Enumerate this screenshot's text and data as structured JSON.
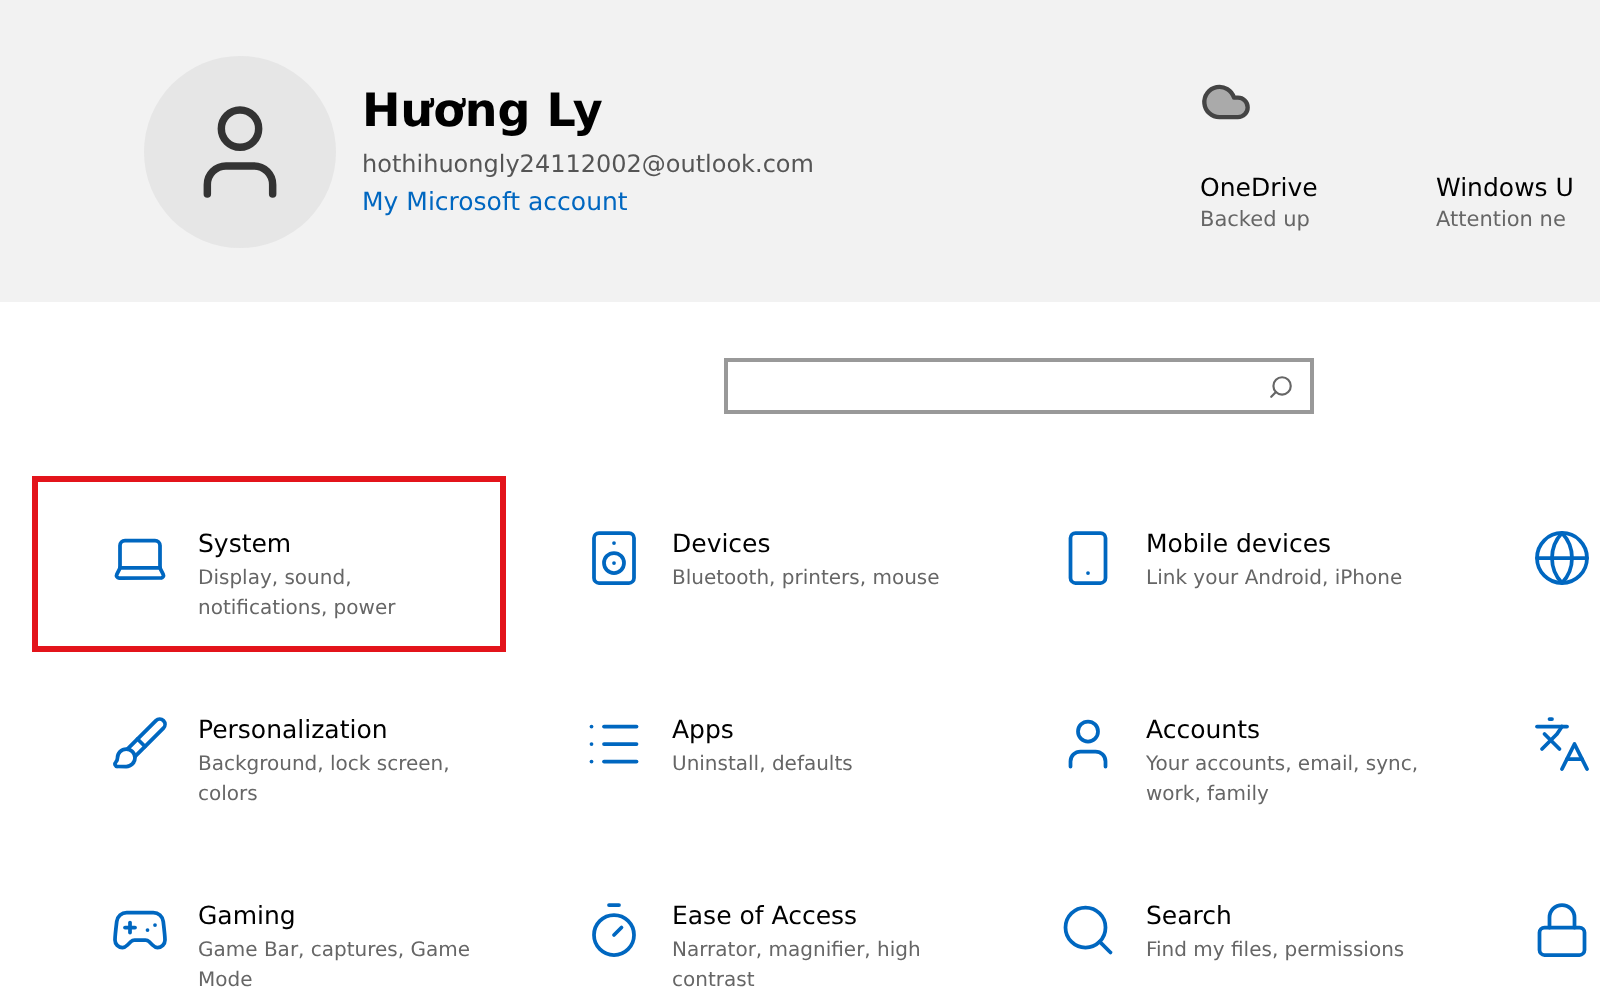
{
  "profile": {
    "name": "Hương Ly",
    "email": "hothihuongly24112002@outlook.com",
    "account_link": "My Microsoft account"
  },
  "status": [
    {
      "title": "OneDrive",
      "subtitle": "Backed up",
      "kind": "onedrive"
    },
    {
      "title": "Windows U",
      "subtitle": "Attention ne",
      "kind": "update"
    }
  ],
  "tiles": [
    {
      "kind": "full",
      "title": "System",
      "subtitle": "Display, sound, notifications, power",
      "highlighted": true
    },
    {
      "kind": "full",
      "title": "Devices",
      "subtitle": "Bluetooth, printers, mouse",
      "highlighted": false
    },
    {
      "kind": "full",
      "title": "Mobile devices",
      "subtitle": "Link your Android, iPhone",
      "highlighted": false
    },
    {
      "kind": "cut",
      "highlighted": false
    },
    {
      "kind": "full",
      "title": "Personalization",
      "subtitle": "Background, lock screen, colors",
      "highlighted": false
    },
    {
      "kind": "full",
      "title": "Apps",
      "subtitle": "Uninstall, defaults",
      "highlighted": false
    },
    {
      "kind": "full",
      "title": "Accounts",
      "subtitle": "Your accounts, email, sync, work, family",
      "highlighted": false
    },
    {
      "kind": "cut",
      "highlighted": false
    },
    {
      "kind": "full",
      "title": "Gaming",
      "subtitle": "Game Bar, captures, Game Mode",
      "highlighted": false
    },
    {
      "kind": "full",
      "title": "Ease of Access",
      "subtitle": "Narrator, magnifier, high contrast",
      "highlighted": false
    },
    {
      "kind": "full",
      "title": "Search",
      "subtitle": "Find my files, permissions",
      "highlighted": false
    },
    {
      "kind": "cut",
      "highlighted": false
    }
  ]
}
